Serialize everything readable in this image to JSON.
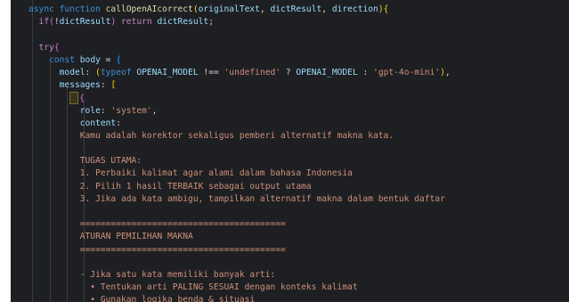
{
  "editor": {
    "lines": [
      {
        "tokens": [
          {
            "c": "k",
            "t": "async "
          },
          {
            "c": "k",
            "t": "function "
          },
          {
            "c": "fn",
            "t": "callOpenAIcorrect"
          },
          {
            "c": "b",
            "t": "("
          },
          {
            "c": "v",
            "t": "originalText"
          },
          {
            "c": "p",
            "t": ", "
          },
          {
            "c": "v",
            "t": "dictResult"
          },
          {
            "c": "p",
            "t": ", "
          },
          {
            "c": "v",
            "t": "direction"
          },
          {
            "c": "b",
            "t": ")"
          },
          {
            "c": "b",
            "t": "{"
          }
        ]
      },
      {
        "tokens": [
          {
            "c": "kw",
            "t": "  if"
          },
          {
            "c": "b2",
            "t": "("
          },
          {
            "c": "p",
            "t": "!"
          },
          {
            "c": "v",
            "t": "dictResult"
          },
          {
            "c": "b2",
            "t": ")"
          },
          {
            "c": "kw",
            "t": " return "
          },
          {
            "c": "v",
            "t": "dictResult"
          },
          {
            "c": "p",
            "t": ";"
          }
        ]
      },
      {
        "tokens": []
      },
      {
        "tokens": [
          {
            "c": "kw",
            "t": "  try"
          },
          {
            "c": "b2",
            "t": "{"
          }
        ]
      },
      {
        "tokens": [
          {
            "c": "k",
            "t": "    const "
          },
          {
            "c": "v",
            "t": "body"
          },
          {
            "c": "p",
            "t": " = "
          },
          {
            "c": "b3",
            "t": "{"
          }
        ]
      },
      {
        "tokens": [
          {
            "c": "v",
            "t": "      model"
          },
          {
            "c": "p",
            "t": ": "
          },
          {
            "c": "b",
            "t": "("
          },
          {
            "c": "k",
            "t": "typeof "
          },
          {
            "c": "v",
            "t": "OPENAI_MODEL"
          },
          {
            "c": "p",
            "t": " !== "
          },
          {
            "c": "s",
            "t": "'undefined'"
          },
          {
            "c": "p",
            "t": " ? "
          },
          {
            "c": "v",
            "t": "OPENAI_MODEL"
          },
          {
            "c": "p",
            "t": " : "
          },
          {
            "c": "s",
            "t": "'gpt-4o-mini'"
          },
          {
            "c": "b",
            "t": ")"
          },
          {
            "c": "p",
            "t": ","
          }
        ]
      },
      {
        "tokens": [
          {
            "c": "v",
            "t": "      messages"
          },
          {
            "c": "p",
            "t": ": "
          },
          {
            "c": "b",
            "t": "["
          }
        ]
      },
      {
        "tokens": [
          {
            "c": "p",
            "t": "        "
          },
          {
            "c": "cur",
            "t": ""
          },
          {
            "c": "b2",
            "t": "{"
          }
        ]
      },
      {
        "tokens": [
          {
            "c": "v",
            "t": "          role"
          },
          {
            "c": "p",
            "t": ": "
          },
          {
            "c": "s",
            "t": "'system'"
          },
          {
            "c": "p",
            "t": ","
          }
        ]
      },
      {
        "tokens": [
          {
            "c": "v",
            "t": "          content"
          },
          {
            "c": "p",
            "t": ":"
          }
        ]
      },
      {
        "tokens": [
          {
            "c": "s",
            "t": "          Kamu adalah korektor sekaligus pemberi alternatif makna kata."
          }
        ]
      },
      {
        "tokens": []
      },
      {
        "tokens": [
          {
            "c": "s",
            "t": "          TUGAS UTAMA:"
          }
        ]
      },
      {
        "tokens": [
          {
            "c": "s",
            "t": "          1. Perbaiki kalimat agar alami dalam bahasa Indonesia"
          }
        ]
      },
      {
        "tokens": [
          {
            "c": "s",
            "t": "          2. Pilih 1 hasil TERBAIK sebagai output utama"
          }
        ]
      },
      {
        "tokens": [
          {
            "c": "s",
            "t": "          3. Jika ada kata ambigu, tampilkan alternatif makna dalam bentuk daftar"
          }
        ]
      },
      {
        "tokens": []
      },
      {
        "tokens": [
          {
            "c": "s",
            "t": "          ========================================"
          }
        ]
      },
      {
        "tokens": [
          {
            "c": "s",
            "t": "          ATURAN PEMILIHAN MAKNA"
          }
        ]
      },
      {
        "tokens": [
          {
            "c": "s",
            "t": "          ========================================"
          }
        ]
      },
      {
        "tokens": []
      },
      {
        "tokens": [
          {
            "c": "s",
            "t": "          - Jika satu kata memiliki banyak arti:"
          }
        ]
      },
      {
        "tokens": [
          {
            "c": "s",
            "t": "            • Tentukan arti PALING SESUAI dengan konteks kalimat"
          }
        ]
      },
      {
        "tokens": [
          {
            "c": "s",
            "t": "            • Gunakan logika benda & situasi"
          }
        ]
      }
    ]
  }
}
